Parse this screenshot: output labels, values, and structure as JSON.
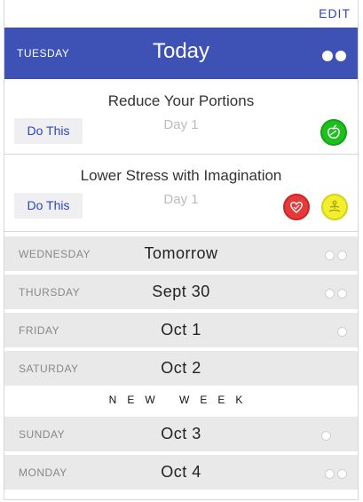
{
  "header": {
    "edit_label": "EDIT"
  },
  "today": {
    "day_name": "TUESDAY",
    "title": "Today",
    "dots": [
      "filled",
      "filled"
    ]
  },
  "tasks": [
    {
      "name": "Reduce Your Portions",
      "day_label": "Day 1",
      "button_label": "Do This",
      "badges": [
        {
          "icon": "apple-icon",
          "color": "#1fbf1f"
        }
      ]
    },
    {
      "name": "Lower Stress with Imagination",
      "day_label": "Day 1",
      "button_label": "Do This",
      "badges": [
        {
          "icon": "heart-icon",
          "color": "#e63a3a"
        },
        {
          "icon": "meditation-icon",
          "color": "#f3ef2e"
        }
      ]
    }
  ],
  "days": [
    {
      "day": "WEDNESDAY",
      "title": "Tomorrow",
      "dots": 2
    },
    {
      "day": "THURSDAY",
      "title": "Sept 30",
      "dots": 2
    },
    {
      "day": "FRIDAY",
      "title": "Oct 1",
      "dots": 1
    },
    {
      "day": "SATURDAY",
      "title": "Oct 2",
      "dots": 0
    },
    {
      "day": "SUNDAY",
      "title": "Oct 3",
      "dots": 1
    },
    {
      "day": "MONDAY",
      "title": "Oct 4",
      "dots": 2
    }
  ],
  "new_week_label": "NEW WEEK"
}
